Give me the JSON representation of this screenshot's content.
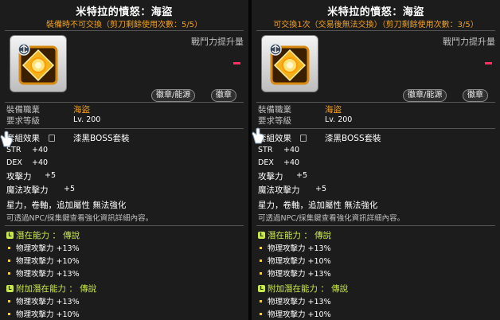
{
  "panels": [
    {
      "title": "米特拉的憤怒：海盜",
      "subtitle": "裝備時不可交換（剪刀剩餘使用次數：5/5）",
      "power_label": "戰鬥力提升量",
      "buttons": [
        "徽章/能源",
        "徽章"
      ],
      "job_label": "裝備職業",
      "job_value": "海盜",
      "level_label": "要求等級",
      "level_value": "Lv. 200",
      "set_label": "套組效果",
      "set_value": "漆黑BOSS套裝",
      "stats": [
        {
          "name": "STR",
          "value": "+40"
        },
        {
          "name": "DEX",
          "value": "+40"
        },
        {
          "name": "攻擊力",
          "value": "+5"
        },
        {
          "name": "魔法攻擊力",
          "value": "+5"
        }
      ],
      "flags": "星力，卷軸，追加屬性 無法強化",
      "hint": "可透過NPC/採集鍵查看強化資訊詳細內容。",
      "potential": {
        "badge": "L",
        "title": "潛在能力 ： 傳說",
        "lines": [
          "物理攻擊力 +13%",
          "物理攻擊力 +10%",
          "物理攻擊力 +13%"
        ]
      },
      "bonus_potential": {
        "badge": "L",
        "title": "附加潛在能力 ： 傳說",
        "lines": [
          "物理攻擊力 +13%",
          "物理攻擊力 +10%"
        ]
      }
    },
    {
      "title": "米特拉的憤怒：海盜",
      "subtitle": "可交換1次（交易後無法交換）（剪刀剩餘使用次數：3/5）",
      "power_label": "戰鬥力提升量",
      "buttons": [
        "徽章/能源",
        "徽章"
      ],
      "job_label": "裝備職業",
      "job_value": "海盜",
      "level_label": "要求等級",
      "level_value": "Lv. 200",
      "set_label": "套組效果",
      "set_value": "漆黑BOSS套裝",
      "stats": [
        {
          "name": "STR",
          "value": "+40"
        },
        {
          "name": "DEX",
          "value": "+40"
        },
        {
          "name": "攻擊力",
          "value": "+5"
        },
        {
          "name": "魔法攻擊力",
          "value": "+5"
        }
      ],
      "flags": "星力，卷軸，追加屬性 無法強化",
      "hint": "可透過NPC/採集鍵查看強化資訊詳細內容。",
      "potential": {
        "badge": "L",
        "title": "潛在能力 ： 傳說",
        "lines": [
          "物理攻擊力 +13%",
          "物理攻擊力 +10%",
          "物理攻擊力 +13%"
        ]
      },
      "bonus_potential": {
        "badge": "L",
        "title": "附加潛在能力 ： 傳說",
        "lines": [
          "物理攻擊力 +13%",
          "物理攻擊力 +10%"
        ]
      }
    }
  ],
  "colors": {
    "accent": "#f0a020",
    "legend": "#c9e84d",
    "negative": "#ff3060"
  },
  "icons": {
    "item": "emblem-item-icon",
    "cursor": "hand-cursor-icon",
    "lock": "lock-icon"
  }
}
